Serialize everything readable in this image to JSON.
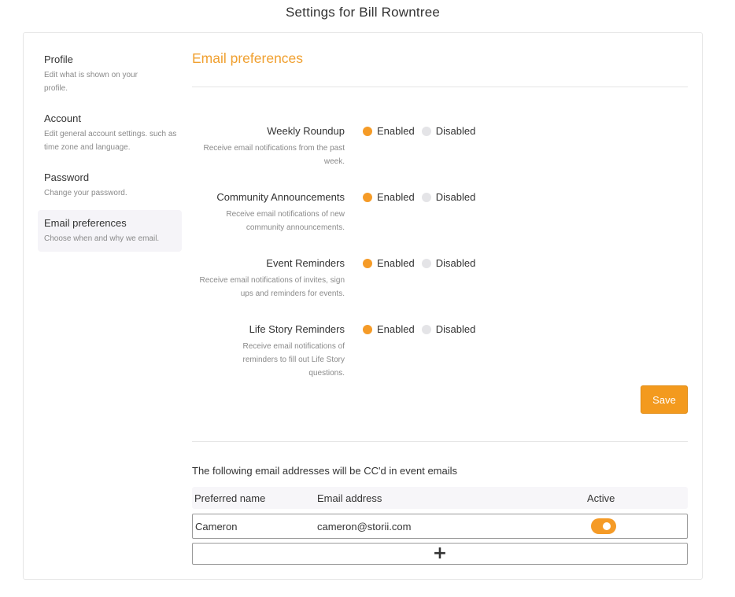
{
  "page": {
    "title": "Settings for Bill Rowntree"
  },
  "sidebar": {
    "items": [
      {
        "title": "Profile",
        "description": "Edit what is shown on your profile.",
        "active": false
      },
      {
        "title": "Account",
        "description": "Edit general account settings. such as time zone and language.",
        "active": false
      },
      {
        "title": "Password",
        "description": "Change your password.",
        "active": false
      },
      {
        "title": "Email preferences",
        "description": "Choose when and why we email.",
        "active": true
      }
    ]
  },
  "main": {
    "section_title": "Email preferences",
    "enabled_label": "Enabled",
    "disabled_label": "Disabled",
    "preferences": [
      {
        "name": "Weekly Roundup",
        "description": "Receive email notifications from the past week.",
        "value": "Enabled"
      },
      {
        "name": "Community Announcements",
        "description": "Receive email notifications of new community announcements.",
        "value": "Enabled"
      },
      {
        "name": "Event Reminders",
        "description": "Receive email notifications of invites, sign ups and reminders for events.",
        "value": "Enabled"
      },
      {
        "name": "Life Story Reminders",
        "description": "Receive email notifications of reminders to fill out Life Story questions.",
        "value": "Enabled"
      }
    ],
    "save_label": "Save",
    "cc_text": "The following email addresses will be CC'd in event emails",
    "table": {
      "headers": [
        "Preferred name",
        "Email address",
        "Active"
      ],
      "rows": [
        {
          "name": "Cameron",
          "email": "cameron@storii.com",
          "active": true
        }
      ],
      "add_icon": "plus-icon"
    }
  },
  "colors": {
    "accent": "#f39a1e",
    "radio_off": "#e4e4e7",
    "active_nav_bg": "#f5f4f8"
  }
}
